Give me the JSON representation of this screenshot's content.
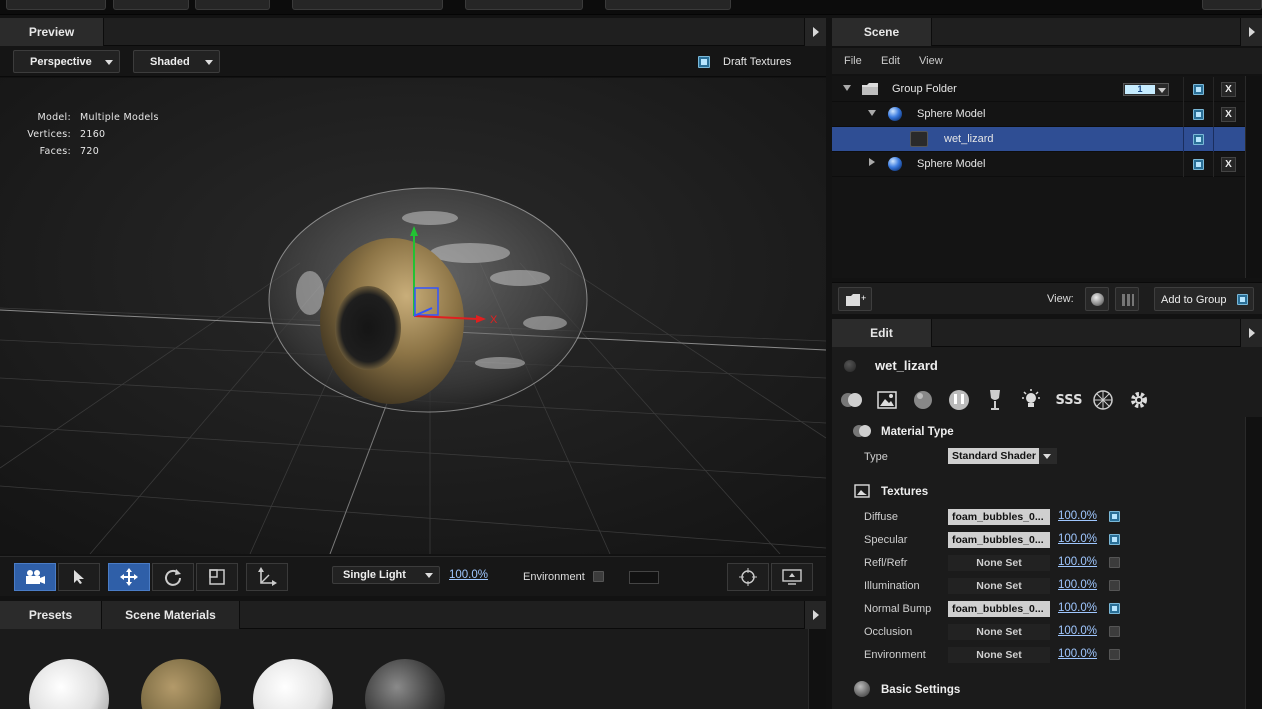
{
  "colors": {
    "accent": "#2f5fa8",
    "selection": "#2f4e94",
    "link": "#9fc7ff",
    "checkbox_on": "#b7e6ff"
  },
  "preview": {
    "title": "Preview",
    "camera_dropdown": "Perspective",
    "shading_dropdown": "Shaded",
    "draft_textures_label": "Draft Textures",
    "stats": [
      {
        "label": "Model:",
        "value": "Multiple Models"
      },
      {
        "label": "Vertices:",
        "value": "2160"
      },
      {
        "label": "Faces:",
        "value": "720"
      }
    ],
    "gizmo_x_label": "X"
  },
  "viewport_toolbar": {
    "tools": [
      "camera-icon",
      "pointer-icon",
      "move-icon",
      "rotate-icon",
      "scale-icon",
      "axis-icon"
    ],
    "active_tool": "move-icon",
    "light_dropdown": "Single Light",
    "light_intensity": "100.0%",
    "environment_label": "Environment"
  },
  "presets": {
    "tabs": [
      "Presets",
      "Scene Materials"
    ]
  },
  "scene": {
    "title": "Scene",
    "menu": [
      "File",
      "Edit",
      "View"
    ],
    "tree": [
      {
        "label": "Group Folder",
        "type": "folder",
        "expanded": true,
        "counter": "1",
        "has_delete": true
      },
      {
        "label": "Sphere Model",
        "type": "sphere",
        "expanded": true,
        "has_delete": true
      },
      {
        "label": "wet_lizard",
        "type": "material",
        "selected": true,
        "has_delete": false
      },
      {
        "label": "Sphere Model",
        "type": "sphere",
        "expanded": false,
        "has_delete": true
      }
    ],
    "delete_label": "X",
    "footer": {
      "view_label": "View:",
      "add_to_group_label": "Add to Group"
    }
  },
  "edit": {
    "title": "Edit",
    "material_name": "wet_lizard",
    "toolbar_icons": [
      "material-type-icon",
      "textures-icon",
      "sphere-icon",
      "reflection-icon",
      "glass-icon",
      "light-icon",
      "sss-icon",
      "normal-icon",
      "settings-icon"
    ],
    "sss_label": "SSS",
    "material_type": {
      "heading": "Material Type",
      "type_label": "Type",
      "type_value": "Standard Shader"
    },
    "textures": {
      "heading": "Textures",
      "rows": [
        {
          "label": "Diffuse",
          "value": "foam_bubbles_0...",
          "percent": "100.0%",
          "enabled": true
        },
        {
          "label": "Specular",
          "value": "foam_bubbles_0...",
          "percent": "100.0%",
          "enabled": true
        },
        {
          "label": "Refl/Refr",
          "value": "None Set",
          "percent": "100.0%",
          "enabled": false
        },
        {
          "label": "Illumination",
          "value": "None Set",
          "percent": "100.0%",
          "enabled": false
        },
        {
          "label": "Normal Bump",
          "value": "foam_bubbles_0...",
          "percent": "100.0%",
          "enabled": true
        },
        {
          "label": "Occlusion",
          "value": "None Set",
          "percent": "100.0%",
          "enabled": false
        },
        {
          "label": "Environment",
          "value": "None Set",
          "percent": "100.0%",
          "enabled": false
        }
      ]
    },
    "basic_settings_heading": "Basic Settings"
  }
}
